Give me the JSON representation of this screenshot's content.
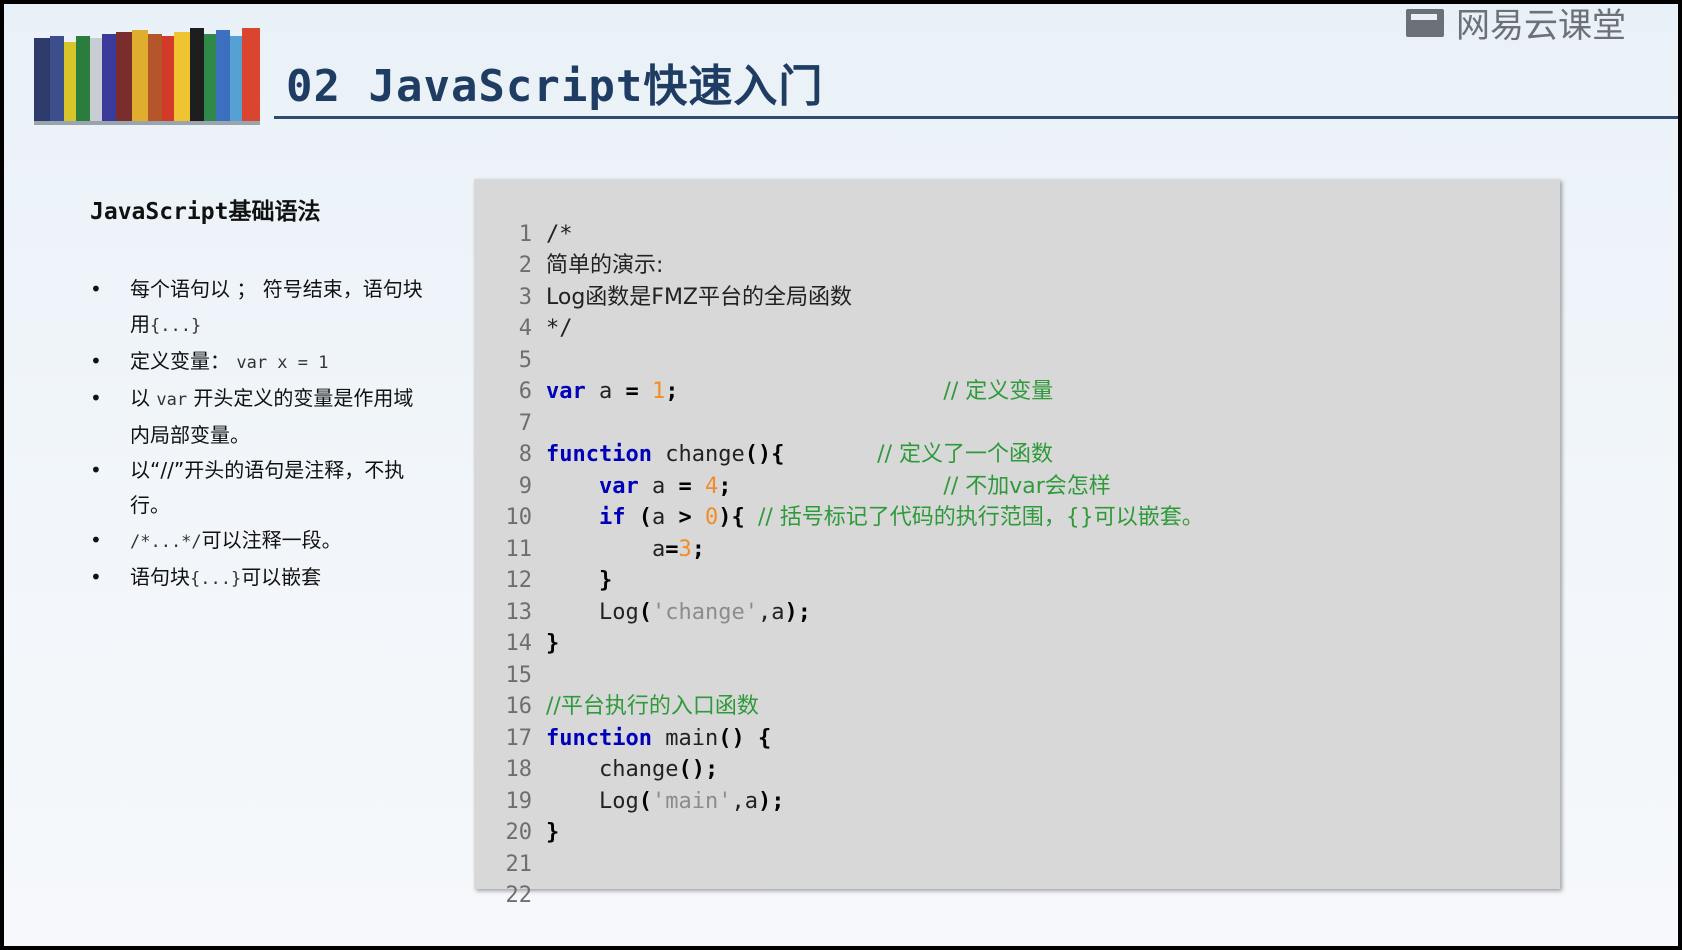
{
  "slide": {
    "title": "02 JavaScript快速入门",
    "watermark_text": "网易云课堂",
    "watermark_icon": "book-screen-icon"
  },
  "sidebar": {
    "heading": "JavaScript基础语法",
    "bullets": [
      {
        "text": "每个语句以 ； 符号结束，语句块用",
        "code": "{...}",
        "after": ""
      },
      {
        "text": "定义变量： ",
        "code": "var x = 1",
        "after": ""
      },
      {
        "text": "以 ",
        "code": "var",
        "after": " 开头定义的变量是作用域内局部变量。"
      },
      {
        "text": "以“//”开头的语句是注释，不执行。",
        "code": "",
        "after": ""
      },
      {
        "text": "",
        "code": "/*...*/",
        "after": "可以注释一段。"
      },
      {
        "text": "语句块",
        "code": "{...}",
        "after": "可以嵌套"
      }
    ]
  },
  "code": {
    "line_numbers": [
      "1",
      "2",
      "3",
      "4",
      "5",
      "6",
      "7",
      "8",
      "9",
      "10",
      "11",
      "12",
      "13",
      "14",
      "15",
      "16",
      "17",
      "18",
      "19",
      "20",
      "21",
      "22"
    ],
    "lines": {
      "l1": "/*",
      "l2": "简单的演示:",
      "l3": "Log函数是FMZ平台的全局函数",
      "l4": "*/",
      "l6_kw": "var",
      "l6_a": " a ",
      "l6_eq": "=",
      "l6_num": "1",
      "l6_semi": ";",
      "l6_cm": "// 定义变量",
      "l8_kw": "function",
      "l8_name": " change",
      "l8_p": "(){",
      "l8_cm": "// 定义了一个函数",
      "l9_kw": "var",
      "l9_a": " a ",
      "l9_eq": "=",
      "l9_num": "4",
      "l9_semi": ";",
      "l9_cm": "// 不加var会怎样",
      "l10_kw": "if",
      "l10_p1": "(",
      "l10_a": "a ",
      "l10_op": ">",
      "l10_num": "0",
      "l10_p2": "){",
      "l10_cm": "// 括号标记了代码的执行范围，{}可以嵌套。",
      "l11_a": "a",
      "l11_eq": "=",
      "l11_num": "3",
      "l11_semi": ";",
      "l12": "}",
      "l13_fn": "Log",
      "l13_p1": "(",
      "l13_str": "'change'",
      "l13_rest": ",a",
      "l13_p2": ");",
      "l14": "}",
      "l16_cm": "//平台执行的入口函数",
      "l17_kw": "function",
      "l17_name": " main",
      "l17_p": "() {",
      "l18_fn": "change",
      "l18_p": "();",
      "l19_fn": "Log",
      "l19_p1": "(",
      "l19_str": "'main'",
      "l19_rest": ",a",
      "l19_p2": ");",
      "l20": "}"
    }
  },
  "colors": {
    "title": "#1f3c63",
    "keyword": "#0000bb",
    "number": "#f28c28",
    "string": "#8c8c8c",
    "comment": "#2e9a3a",
    "panel": "#d8d8d8"
  }
}
